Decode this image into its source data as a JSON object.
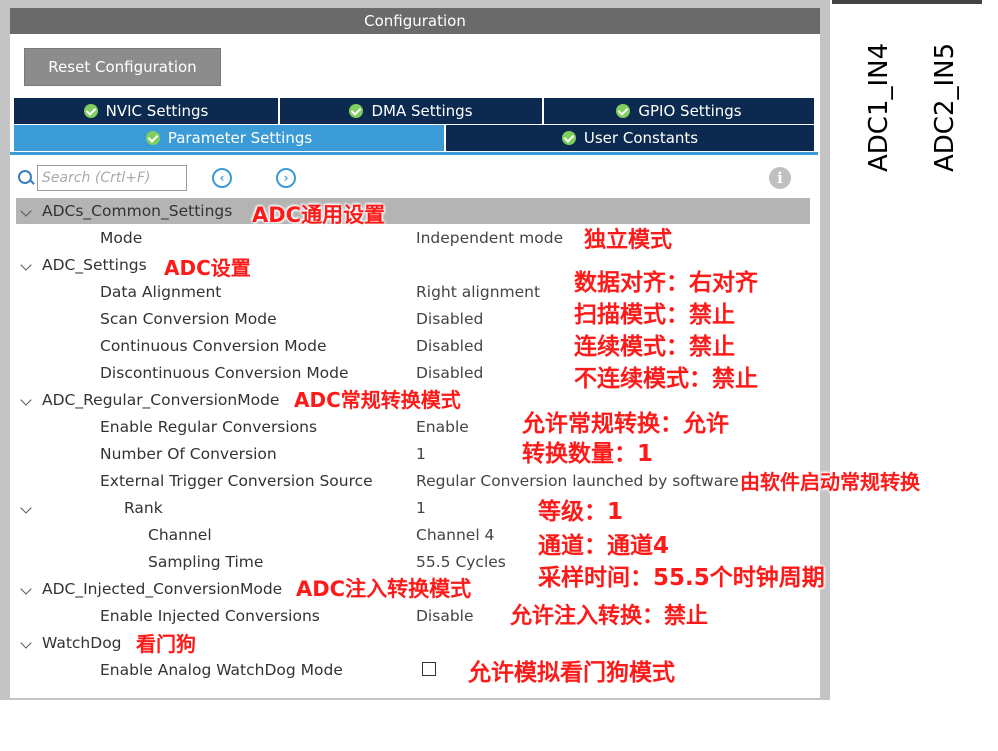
{
  "window": {
    "title": "Configuration"
  },
  "toolbar": {
    "reset_label": "Reset Configuration"
  },
  "tabs": [
    {
      "label": "NVIC Settings"
    },
    {
      "label": "DMA Settings"
    },
    {
      "label": "GPIO Settings"
    },
    {
      "label": "Parameter Settings",
      "active": true
    },
    {
      "label": "User Constants"
    }
  ],
  "search": {
    "placeholder": "Search (Crtl+F)"
  },
  "tree": [
    {
      "label": "ADCs_Common_Settings",
      "value": ""
    },
    {
      "label": "Mode",
      "value": "Independent mode"
    },
    {
      "label": "ADC_Settings",
      "value": ""
    },
    {
      "label": "Data Alignment",
      "value": "Right alignment"
    },
    {
      "label": "Scan Conversion Mode",
      "value": "Disabled"
    },
    {
      "label": "Continuous Conversion Mode",
      "value": "Disabled"
    },
    {
      "label": "Discontinuous Conversion Mode",
      "value": "Disabled"
    },
    {
      "label": "ADC_Regular_ConversionMode",
      "value": ""
    },
    {
      "label": "Enable Regular Conversions",
      "value": "Enable"
    },
    {
      "label": "Number Of Conversion",
      "value": "1"
    },
    {
      "label": "External Trigger Conversion Source",
      "value": "Regular Conversion launched by software"
    },
    {
      "label": "Rank",
      "value": "1"
    },
    {
      "label": "Channel",
      "value": "Channel 4"
    },
    {
      "label": "Sampling Time",
      "value": "55.5 Cycles"
    },
    {
      "label": "ADC_Injected_ConversionMode",
      "value": ""
    },
    {
      "label": "Enable Injected Conversions",
      "value": "Disable"
    },
    {
      "label": "WatchDog",
      "value": ""
    },
    {
      "label": "Enable Analog WatchDog Mode",
      "value": ""
    }
  ],
  "annotations": {
    "common": "ADC通用设置",
    "independent": "独立模式",
    "adc_settings": "ADC设置",
    "data_align": "数据对齐：右对齐",
    "scan": "扫描模式：禁止",
    "continuous": "连续模式：禁止",
    "discontinuous": "不连续模式：禁止",
    "regular_mode": "ADC常规转换模式",
    "enable_regular": "允许常规转换：允许",
    "conv_count": "转换数量：1",
    "software": "由软件启动常规转换",
    "rank": "等级：1",
    "channel": "通道：通道4",
    "sampling": "采样时间：55.5个时钟周期",
    "injected_mode": "ADC注入转换模式",
    "enable_injected": "允许注入转换：禁止",
    "watchdog": "看门狗",
    "analog_watchdog": "允许模拟看门狗模式"
  },
  "side_labels": [
    "ADC1_IN4",
    "ADC2_IN5"
  ],
  "colors": {
    "tab_dark": "#0c2a4f",
    "tab_active": "#3b9bd6",
    "annotation": "#ff1a1a"
  }
}
